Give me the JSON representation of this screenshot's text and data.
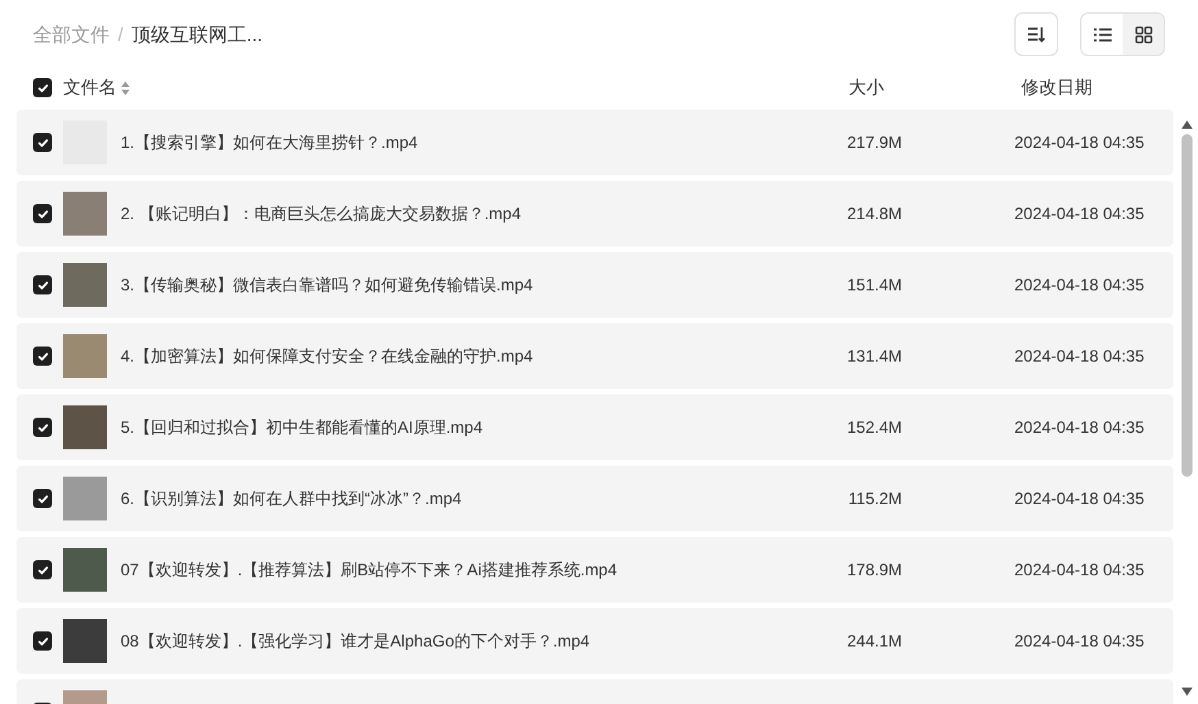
{
  "breadcrumb_separator": "/",
  "breadcrumb": [
    {
      "label": "全部文件",
      "current": false
    },
    {
      "label": "顶级互联网工...",
      "current": true
    }
  ],
  "view_modes": [
    {
      "kind": "list",
      "selected": true
    },
    {
      "kind": "grid",
      "selected": false
    }
  ],
  "columns": {
    "select_all_checked": true,
    "name": "文件名",
    "size": "大小",
    "date": "修改日期"
  },
  "files": [
    {
      "checked": true,
      "name": "1.【搜索引擎】如何在大海里捞针？.mp4",
      "size": "217.9M",
      "date": "2024-04-18 04:35"
    },
    {
      "checked": true,
      "name": "2. 【账记明白】：电商巨头怎么搞庞大交易数据？.mp4",
      "size": "214.8M",
      "date": "2024-04-18 04:35"
    },
    {
      "checked": true,
      "name": "3.【传输奥秘】微信表白靠谱吗？如何避免传输错误.mp4",
      "size": "151.4M",
      "date": "2024-04-18 04:35"
    },
    {
      "checked": true,
      "name": "4.【加密算法】如何保障支付安全？在线金融的守护.mp4",
      "size": "131.4M",
      "date": "2024-04-18 04:35"
    },
    {
      "checked": true,
      "name": "5.【回归和过拟合】初中生都能看懂的AI原理.mp4",
      "size": "152.4M",
      "date": "2024-04-18 04:35"
    },
    {
      "checked": true,
      "name": "6.【识别算法】如何在人群中找到“冰冰”？.mp4",
      "size": "115.2M",
      "date": "2024-04-18 04:35"
    },
    {
      "checked": true,
      "name": "07【欢迎转发】.【推荐算法】刷B站停不下来？Ai搭建推荐系统.mp4",
      "size": "178.9M",
      "date": "2024-04-18 04:35"
    },
    {
      "checked": true,
      "name": "08【欢迎转发】.【强化学习】谁才是AlphaGo的下个对手？.mp4",
      "size": "244.1M",
      "date": "2024-04-18 04:35"
    },
    {
      "checked": true
    }
  ]
}
